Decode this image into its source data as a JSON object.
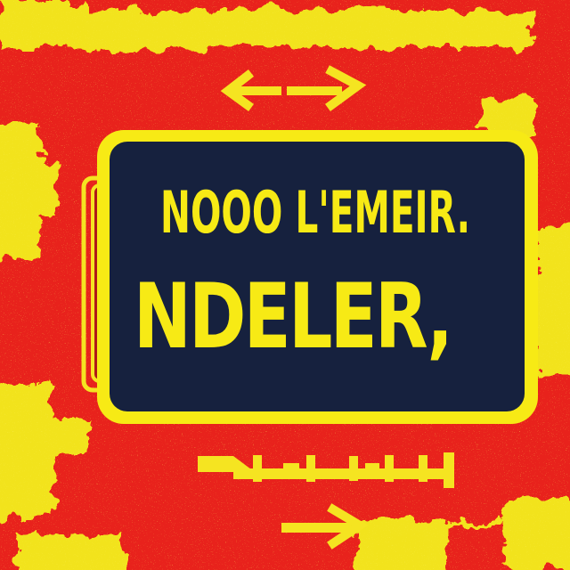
{
  "sign": {
    "line1": "NOOO L'EMEIR.",
    "line2": "NDELER,"
  },
  "colors": {
    "background_red": "#e8231d",
    "accent_yellow": "#f5e421",
    "panel_navy": "#16213e",
    "text_yellow": "#f7ea15"
  },
  "icons": [
    "left-arrow-icon",
    "right-arrow-icon",
    "right-arrow-icon"
  ]
}
